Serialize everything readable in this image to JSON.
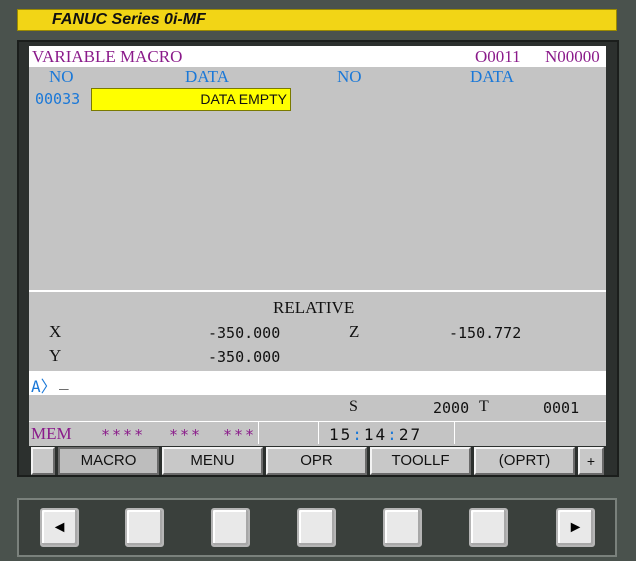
{
  "app": {
    "title": "FANUC Series 0i-MF"
  },
  "screen": {
    "title": "VARIABLE MACRO",
    "program": "O0011",
    "sequence": "N00000"
  },
  "table": {
    "headers": [
      "NO",
      "DATA",
      "NO",
      "DATA"
    ],
    "rows": [
      {
        "no": "00033",
        "data": "DATA EMPTY"
      }
    ]
  },
  "relative": {
    "title": "RELATIVE",
    "axes": [
      {
        "name": "X",
        "value": "-350.000"
      },
      {
        "name": "Y",
        "value": "-350.000"
      },
      {
        "name": "Z",
        "value": "-150.772"
      }
    ]
  },
  "input": {
    "prompt": "A〉",
    "cursor": "_"
  },
  "spindle": {
    "label": "S",
    "value": "2000"
  },
  "tool": {
    "label": "T",
    "value": "0001"
  },
  "status": {
    "mode": "MEM",
    "field1": "****",
    "field2": "***",
    "field3": "***",
    "clock": {
      "h": "15",
      "m": "14",
      "s": "27",
      "sep": ":"
    }
  },
  "softkeys": [
    "MACRO",
    "MENU",
    "OPR",
    "TOOLLF",
    "(OPRT)",
    "+"
  ],
  "panel_keys": {
    "left": "◄",
    "right": "►"
  },
  "colors": {
    "title_bar": "#f2d516",
    "accent_purple": "#8a1a8a",
    "accent_blue": "#1a78d8",
    "highlight": "#ffff00"
  }
}
